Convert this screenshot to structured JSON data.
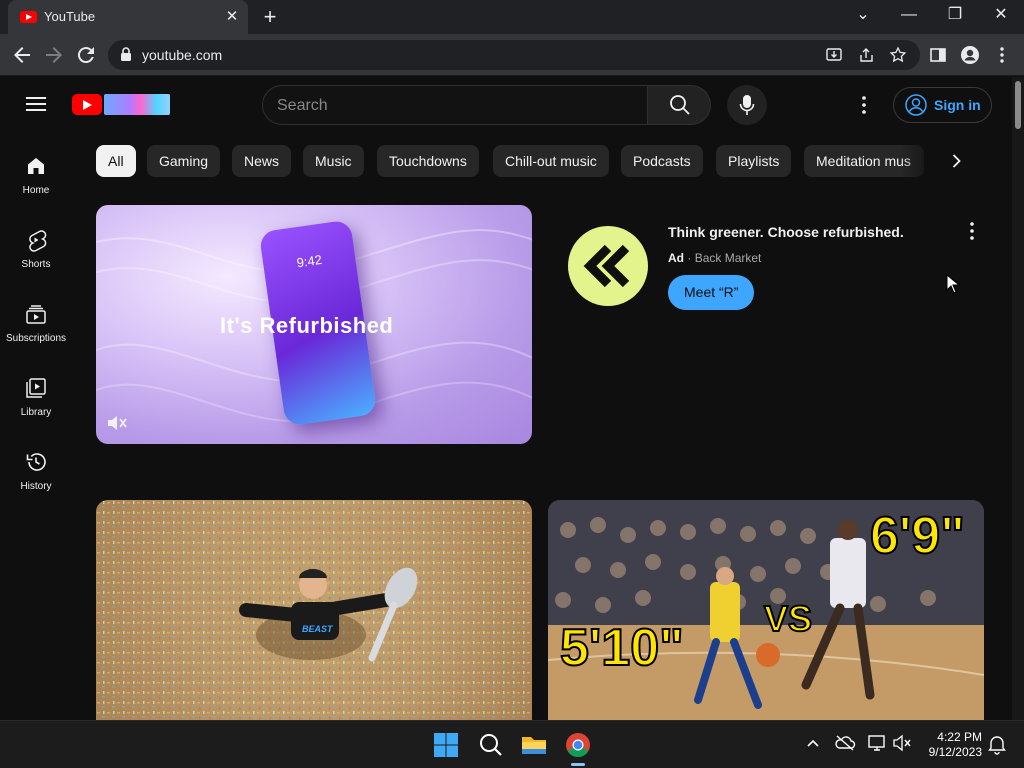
{
  "browser": {
    "tab_title": "YouTube",
    "close_glyph": "✕",
    "newtab_glyph": "+",
    "url": "youtube.com",
    "window_controls": {
      "minimize": "—",
      "restore": "❐",
      "close": "✕",
      "tabsearch": "⌄"
    }
  },
  "header": {
    "search_placeholder": "Search",
    "signin_label": "Sign in"
  },
  "sidebar": {
    "items": [
      {
        "label": "Home",
        "icon": "home-icon"
      },
      {
        "label": "Shorts",
        "icon": "shorts-icon"
      },
      {
        "label": "Subscriptions",
        "icon": "subscriptions-icon"
      },
      {
        "label": "Library",
        "icon": "library-icon"
      },
      {
        "label": "History",
        "icon": "history-icon"
      }
    ]
  },
  "chips": [
    "All",
    "Gaming",
    "News",
    "Music",
    "Touchdowns",
    "Chill-out music",
    "Podcasts",
    "Playlists",
    "Meditation mus"
  ],
  "ad": {
    "thumb_text": "It's Refurbished",
    "phone_time": "9:42",
    "title": "Think greener. Choose refurbished.",
    "badge": "Ad",
    "separator": "·",
    "advertiser": "Back Market",
    "cta": "Meet “R”"
  },
  "videos": {
    "thumb1": {
      "shirt_text": "BEAST"
    },
    "thumb2": {
      "height_left": "5'10\"",
      "vs": "VS",
      "height_right": "6'9\""
    }
  },
  "taskbar": {
    "time": "4:22 PM",
    "date": "9/12/2023"
  },
  "colors": {
    "youtube_red": "#ff0000",
    "link_blue": "#3ea6ff",
    "background": "#0f0f0f",
    "chip": "#272727",
    "ad_logo": "#e3f48c"
  }
}
